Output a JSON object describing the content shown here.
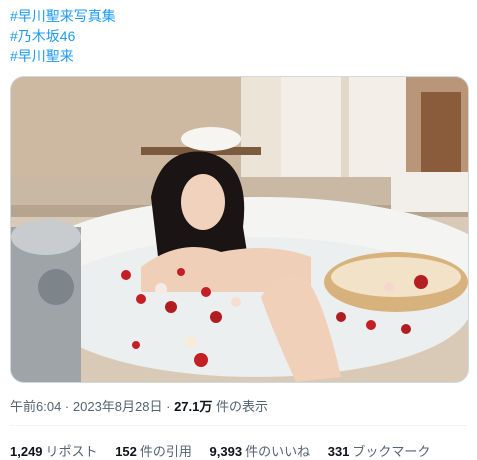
{
  "tweet": {
    "hashtags": [
      "#早川聖来写真集",
      "#乃木坂46",
      "#早川聖来"
    ],
    "time": "午前6:04",
    "sep1": " · ",
    "date": "2023年8月28日",
    "sep2": " · ",
    "views_count": "27.1万",
    "views_label": " 件の表示"
  },
  "stats": [
    {
      "num": "1,249",
      "label": "リポスト"
    },
    {
      "num": "152",
      "label": "件の引用"
    },
    {
      "num": "9,393",
      "label": "件のいいね"
    },
    {
      "num": "331",
      "label": "ブックマーク"
    }
  ],
  "colors": {
    "link": "#1d9bf0",
    "text": "#0f1419",
    "muted": "#536471",
    "border": "#cfd9de"
  }
}
